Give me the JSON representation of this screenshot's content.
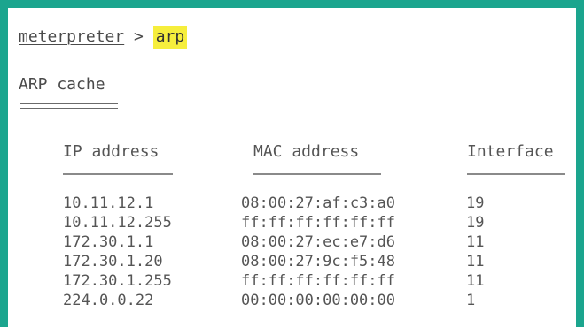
{
  "terminal": {
    "prompt": "meterpreter",
    "separator": " > ",
    "command": "arp",
    "section_title": "ARP cache"
  },
  "table": {
    "columns": [
      "IP address",
      "MAC address",
      "Interface"
    ],
    "rows": [
      [
        "10.11.12.1",
        "08:00:27:af:c3:a0",
        "19"
      ],
      [
        "10.11.12.255",
        "ff:ff:ff:ff:ff:ff",
        "19"
      ],
      [
        "172.30.1.1",
        "08:00:27:ec:e7:d6",
        "11"
      ],
      [
        "172.30.1.20",
        "08:00:27:9c:f5:48",
        "11"
      ],
      [
        "172.30.1.255",
        "ff:ff:ff:ff:ff:ff",
        "11"
      ],
      [
        "224.0.0.22",
        "00:00:00:00:00:00",
        "1"
      ]
    ]
  },
  "colors": {
    "frame": "#1ba58e",
    "highlight": "#f6ee3c",
    "text": "#4a4a4a"
  }
}
